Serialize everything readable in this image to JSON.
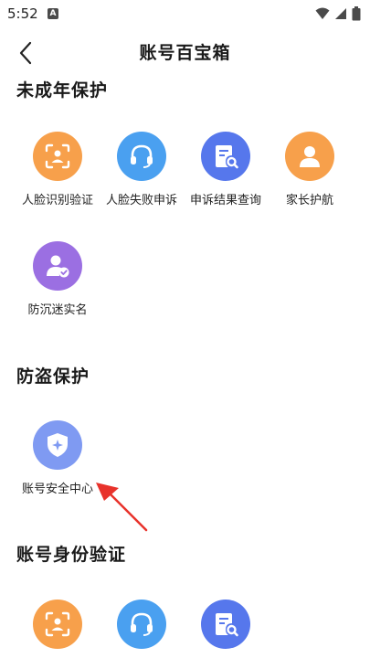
{
  "status_bar": {
    "time": "5:52",
    "notification_letter": "A"
  },
  "header": {
    "title": "账号百宝箱"
  },
  "sections": [
    {
      "title": "未成年保护",
      "items": [
        {
          "label": "人脸识别验证",
          "icon": "face-scan-icon",
          "color": "#f7a04b"
        },
        {
          "label": "人脸失败申诉",
          "icon": "headset-icon",
          "color": "#4aa0f0"
        },
        {
          "label": "申诉结果查询",
          "icon": "document-search-icon",
          "color": "#5677ec"
        },
        {
          "label": "家长护航",
          "icon": "person-icon",
          "color": "#f7a04b"
        },
        {
          "label": "防沉迷实名",
          "icon": "user-verified-icon",
          "color": "#9b6fe2"
        }
      ]
    },
    {
      "title": "防盗保护",
      "items": [
        {
          "label": "账号安全中心",
          "icon": "shield-icon",
          "color": "#7f9af2"
        }
      ]
    },
    {
      "title": "账号身份验证",
      "items": [
        {
          "icon": "face-scan-icon",
          "color": "#f7a04b"
        },
        {
          "icon": "headset-icon",
          "color": "#4aa0f0"
        },
        {
          "icon": "document-search-icon",
          "color": "#5677ec"
        }
      ]
    }
  ],
  "annotation": {
    "arrow_color": "#e8322b"
  }
}
